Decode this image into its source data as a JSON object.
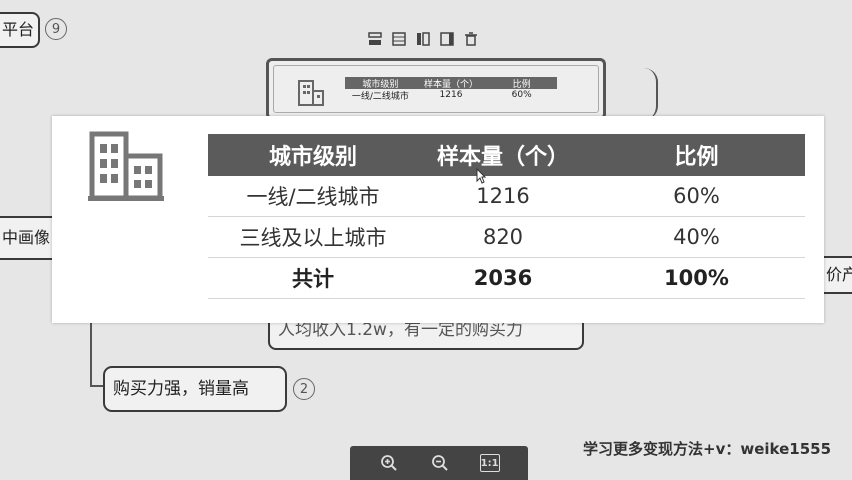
{
  "mindmap": {
    "top_left_node": "平台",
    "top_left_badge": "9",
    "left_node": "中画像",
    "right_node": "价产",
    "income_node": "人均收入1.2w，有一定的购买力",
    "buy_node": "购买力强，销量高",
    "buy_badge": "2"
  },
  "node_toolbar": {
    "icons": [
      "layout-icon",
      "table-icon",
      "columns-icon",
      "split-icon",
      "trash-icon"
    ]
  },
  "table": {
    "headers": [
      "城市级别",
      "样本量（个）",
      "比例"
    ],
    "rows": [
      {
        "level": "一线/二线城市",
        "count": "1216",
        "ratio": "60%"
      },
      {
        "level": "三线及以上城市",
        "count": "820",
        "ratio": "40%"
      },
      {
        "level": "共计",
        "count": "2036",
        "ratio": "100%"
      }
    ]
  },
  "zoom_toolbar": {
    "zoom_in": "zoom-in-icon",
    "zoom_out": "zoom-out-icon",
    "actual_size": "1:1"
  },
  "watermark": "学习更多变现方法+v：weike1555",
  "colors": {
    "background": "#e6e6e6",
    "table_header": "#5b5b5b",
    "overlay": "#ffffff",
    "toolbar": "#444444"
  }
}
